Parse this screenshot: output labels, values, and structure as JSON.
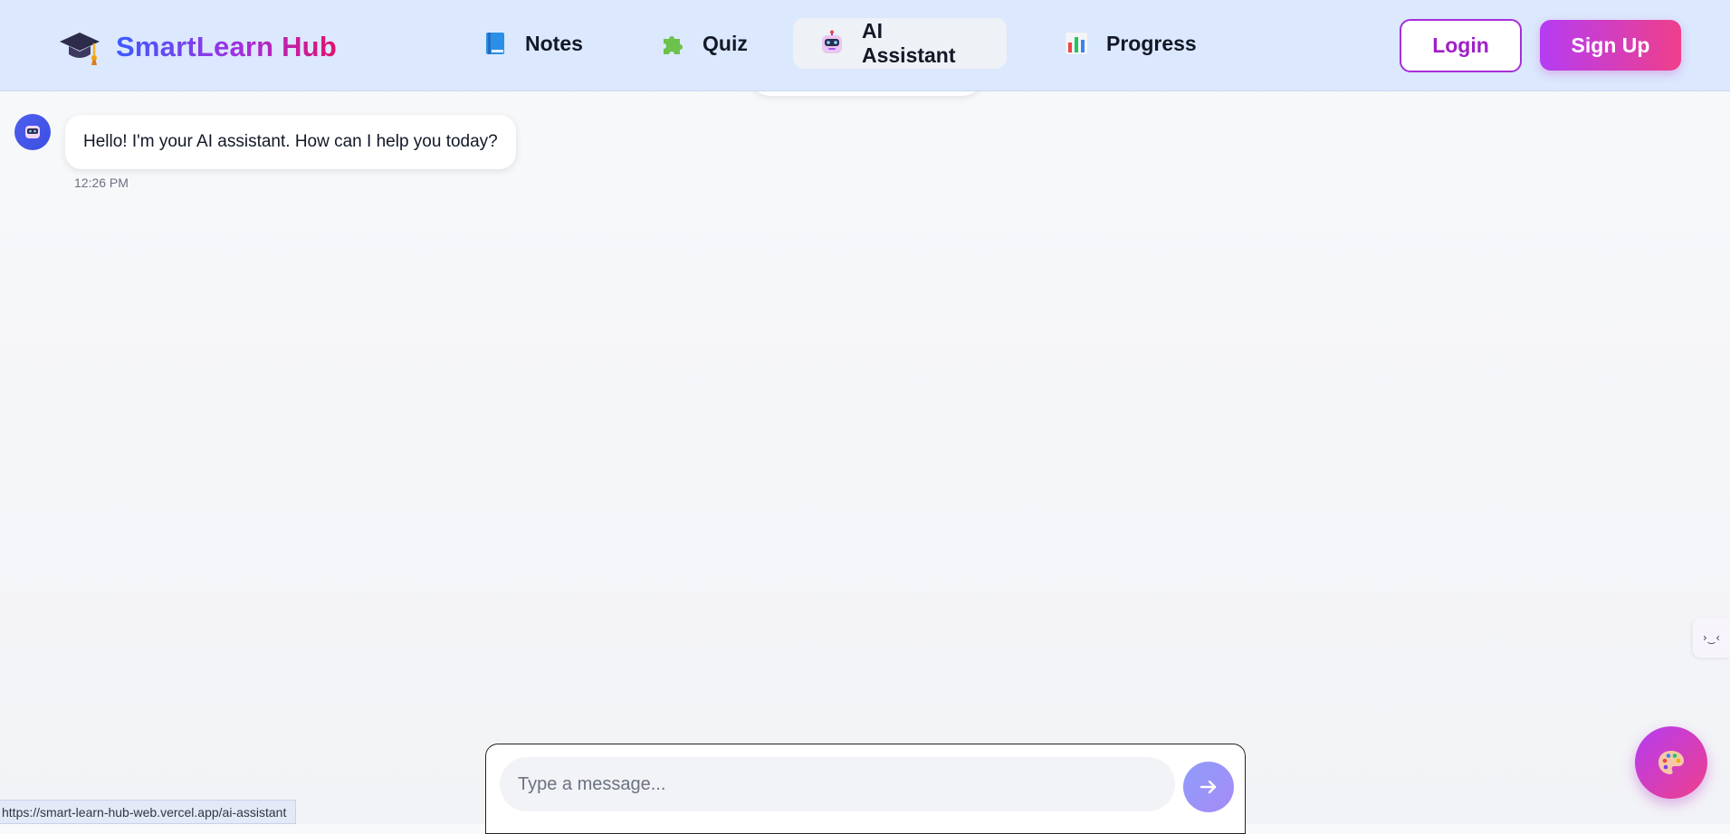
{
  "brand": {
    "title": "SmartLearn Hub",
    "icon": "graduation-cap-icon"
  },
  "nav": {
    "items": [
      {
        "label": "Notes",
        "icon": "book-icon"
      },
      {
        "label": "Quiz",
        "icon": "puzzle-icon"
      },
      {
        "label": "AI Assistant",
        "icon": "robot-icon",
        "active": true
      },
      {
        "label": "Progress",
        "icon": "bar-chart-icon"
      }
    ],
    "login_label": "Login",
    "signup_label": "Sign Up"
  },
  "chat": {
    "messages": [
      {
        "sender": "bot",
        "avatar_icon": "robot-icon",
        "text": "Hello! I'm your AI assistant. How can I help you today?",
        "time": "12:26 PM"
      }
    ]
  },
  "composer": {
    "placeholder": "Type a message...",
    "value": "",
    "send_icon": "arrow-right-icon"
  },
  "side_tab": {
    "text": "›‿‹"
  },
  "theme_button": {
    "icon": "palette-icon"
  },
  "status_bar": {
    "url": "https://smart-learn-hub-web.vercel.app/ai-assistant"
  },
  "colors": {
    "nav_bg": "#dbe8fd",
    "accent_purple": "#a020c8",
    "accent_pink": "#ef3f8a",
    "bot_avatar": "#4f5ff0"
  }
}
